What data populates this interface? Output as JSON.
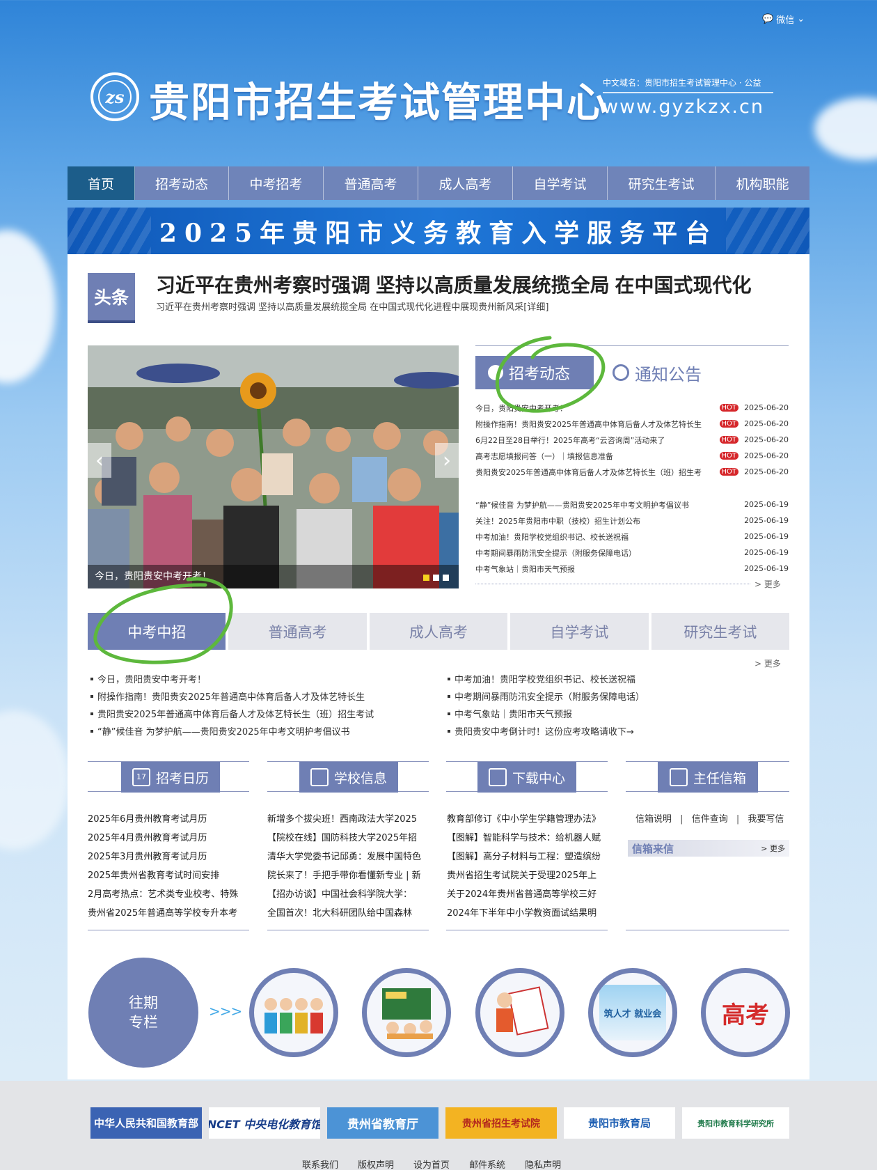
{
  "header": {
    "wechat_label": "微信",
    "site_title": "贵阳市招生考试管理中心",
    "domain_cn": "中文域名：贵阳市招生考试管理中心 · 公益",
    "domain_en": "www.gyzkzx.cn"
  },
  "nav": [
    "首页",
    "招考动态",
    "中考招考",
    "普通高考",
    "成人高考",
    "自学考试",
    "研究生考试",
    "机构职能"
  ],
  "banner": "2025年贵阳市义务教育入学服务平台",
  "headline": {
    "label": "头条",
    "title": "习近平在贵州考察时强调 坚持以高质量发展统揽全局 在中国式现代化",
    "subtitle": "习近平在贵州考察时强调 坚持以高质量发展统揽全局 在中国式现代化进程中展现贵州新风采[详细]"
  },
  "slideshow": {
    "caption": "今日，贵阳贵安中考开考！",
    "prev": "‹",
    "next": "›"
  },
  "news_tabs": {
    "active": "招考动态",
    "other": "通知公告"
  },
  "news_hot": [
    {
      "title": "今日，贵阳贵安中考开考！",
      "hot": "HOT",
      "date": "2025-06-20"
    },
    {
      "title": "附操作指南！贵阳贵安2025年普通高中体育后备人才及体艺特长生",
      "hot": "HOT",
      "date": "2025-06-20"
    },
    {
      "title": "6月22日至28日举行！2025年高考“云咨询周”活动来了",
      "hot": "HOT",
      "date": "2025-06-20"
    },
    {
      "title": "高考志愿填报问答（一）｜填报信息准备",
      "hot": "HOT",
      "date": "2025-06-20"
    },
    {
      "title": "贵阳贵安2025年普通高中体育后备人才及体艺特长生（班）招生考",
      "hot": "HOT",
      "date": "2025-06-20"
    }
  ],
  "news_more": [
    {
      "title": "“静”候佳音 为梦护航——贵阳贵安2025年中考文明护考倡议书",
      "date": "2025-06-19"
    },
    {
      "title": "关注！2025年贵阳市中职（技校）招生计划公布",
      "date": "2025-06-19"
    },
    {
      "title": "中考加油！贵阳学校党组织书记、校长送祝福",
      "date": "2025-06-19"
    },
    {
      "title": "中考期间暴雨防汛安全提示（附服务保障电话）",
      "date": "2025-06-19"
    },
    {
      "title": "中考气象站｜贵阳市天气预报",
      "date": "2025-06-19"
    }
  ],
  "more_label": "> 更多",
  "category_tabs": [
    "中考中招",
    "普通高考",
    "成人高考",
    "自学考试",
    "研究生考试"
  ],
  "category_left": [
    "今日，贵阳贵安中考开考！",
    "附操作指南！贵阳贵安2025年普通高中体育后备人才及体艺特长生",
    "贵阳贵安2025年普通高中体育后备人才及体艺特长生（班）招生考试",
    "“静”候佳音 为梦护航——贵阳贵安2025年中考文明护考倡议书"
  ],
  "category_right": [
    "中考加油！贵阳学校党组织书记、校长送祝福",
    "中考期间暴雨防汛安全提示（附服务保障电话）",
    "中考气象站｜贵阳市天气预报",
    "贵阳贵安中考倒计时！这份应考攻略请收下→"
  ],
  "boxes": {
    "calendar": {
      "icon_text": "17",
      "title": "招考日历",
      "items": [
        "2025年6月贵州教育考试月历",
        "2025年4月贵州教育考试月历",
        "2025年3月贵州教育考试月历",
        "2025年贵州省教育考试时间安排",
        "2月高考热点：艺术类专业校考、特殊",
        "贵州省2025年普通高等学校专升本考"
      ]
    },
    "school": {
      "title": "学校信息",
      "items": [
        "新增多个拔尖班！西南政法大学2025",
        "【院校在线】国防科技大学2025年招",
        "清华大学党委书记邱勇：发展中国特色",
        "院长来了！手把手带你看懂新专业 | 新",
        "【招办访谈】中国社会科学院大学：",
        "全国首次！北大科研团队给中国森林"
      ]
    },
    "download": {
      "title": "下载中心",
      "items": [
        "教育部修订《中小学生学籍管理办法》",
        "【图解】智能科学与技术：给机器人赋",
        "【图解】高分子材料与工程：塑造缤纷",
        "贵州省招生考试院关于受理2025年上",
        "关于2024年贵州省普通高等学校三好",
        "2024年下半年中小学教资面试结果明"
      ]
    },
    "mailbox": {
      "title": "主任信箱",
      "links": [
        "信箱说明",
        "信件查询",
        "我要写信"
      ],
      "bar_title": "信箱来信",
      "bar_more": "> 更多"
    }
  },
  "past": {
    "label_line1": "往期",
    "label_line2": "专栏",
    "arrows": ">>>",
    "ring5_text": "高考",
    "ring4_text": "筑人才 就业会"
  },
  "footer_logos": [
    "中华人民共和国教育部",
    "NCET 中央电化教育馆",
    "贵州省教育厅",
    "贵州省招生考试院",
    "贵阳市教育局",
    "贵阳市教育科学研究所"
  ],
  "footer_links": [
    "联系我们",
    "版权声明",
    "设为首页",
    "邮件系统",
    "隐私声明"
  ],
  "colors": {
    "nav": "#6f84b9",
    "accent": "#6f7fb4",
    "nav_active": "#1c5d8a",
    "hot": "#d6272b",
    "banner": "#1f77d8"
  }
}
